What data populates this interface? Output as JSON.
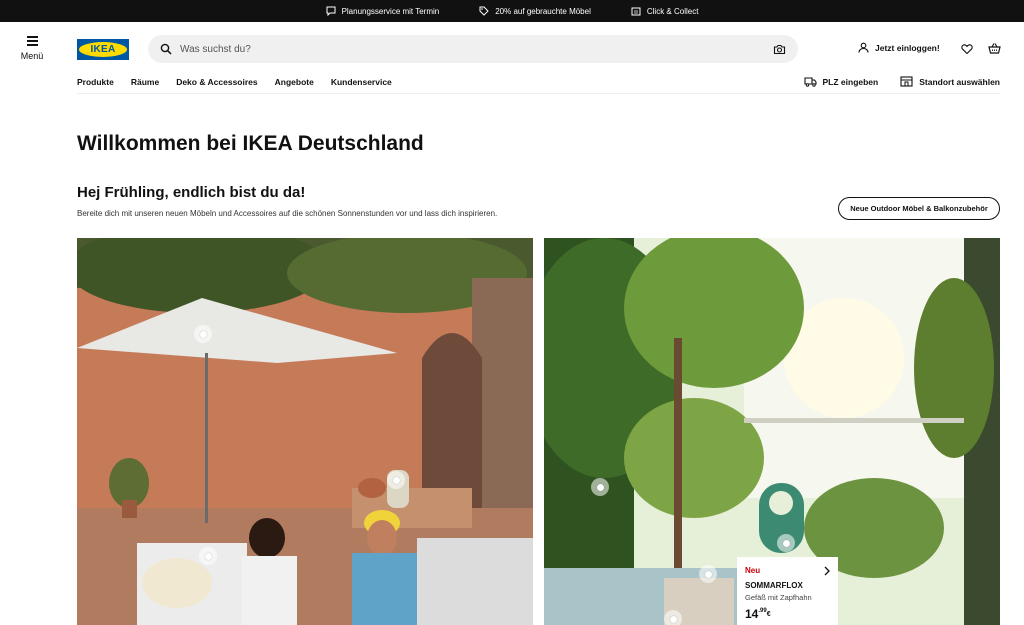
{
  "topbar": {
    "promos": [
      {
        "label": "Planungsservice mit Termin",
        "icon": "chat-icon"
      },
      {
        "label": "20% auf gebrauchte Möbel",
        "icon": "tag-icon"
      },
      {
        "label": "Click & Collect",
        "icon": "store-icon"
      }
    ]
  },
  "header": {
    "menu_label": "Menü",
    "logo_text": "IKEA",
    "search_placeholder": "Was suchst du?",
    "login_label": "Jetzt einloggen!"
  },
  "nav": {
    "items": [
      "Produkte",
      "Räume",
      "Deko & Accessoires",
      "Angebote",
      "Kundenservice"
    ],
    "plz_label": "PLZ eingeben",
    "store_label": "Standort auswählen"
  },
  "main": {
    "page_title": "Willkommen bei IKEA Deutschland",
    "section_title": "Hej Frühling, endlich bist du da!",
    "section_desc": "Bereite dich mit unseren neuen Möbeln und Accessoires auf die schönen Sonnenstunden vor und lass dich inspirieren.",
    "section_button": "Neue Outdoor Möbel & Balkonzubehör"
  },
  "product_card": {
    "badge": "Neu",
    "name": "SOMMARFLOX",
    "description": "Gefäß mit Zapfhahn",
    "price_int": "14",
    "price_dec": ".99",
    "currency": "€"
  },
  "colors": {
    "ikea_blue": "#0058a3",
    "ikea_yellow": "#ffdb00",
    "new_red": "#cc0008",
    "topbar_bg": "#111111"
  }
}
